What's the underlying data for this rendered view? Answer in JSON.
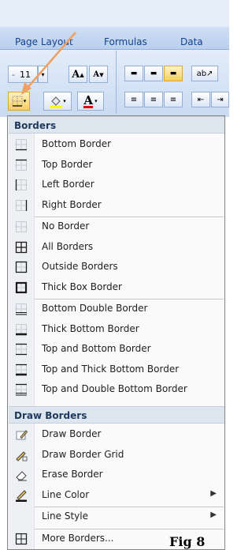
{
  "ribbon": {
    "tabs": [
      "Page Layout",
      "Formulas",
      "Data"
    ],
    "font_size": "11",
    "grow_font": "A",
    "shrink_font": "A",
    "font_color_letter": "A"
  },
  "menu": {
    "header1": "Borders",
    "items1": [
      {
        "label": "Bottom Border",
        "icon": "bottom-border-icon"
      },
      {
        "label": "Top Border",
        "icon": "top-border-icon"
      },
      {
        "label": "Left Border",
        "icon": "left-border-icon"
      },
      {
        "label": "Right Border",
        "icon": "right-border-icon"
      },
      {
        "label": "No Border",
        "icon": "no-border-icon"
      },
      {
        "label": "All Borders",
        "icon": "all-borders-icon"
      },
      {
        "label": "Outside Borders",
        "icon": "outside-borders-icon"
      },
      {
        "label": "Thick Box Border",
        "icon": "thick-box-border-icon"
      },
      {
        "label": "Bottom Double Border",
        "icon": "bottom-double-border-icon"
      },
      {
        "label": "Thick Bottom Border",
        "icon": "thick-bottom-border-icon"
      },
      {
        "label": "Top and Bottom Border",
        "icon": "top-and-bottom-border-icon"
      },
      {
        "label": "Top and Thick Bottom Border",
        "icon": "top-thick-bottom-border-icon"
      },
      {
        "label": "Top and Double Bottom Border",
        "icon": "top-double-bottom-border-icon"
      }
    ],
    "header2": "Draw Borders",
    "items2": [
      {
        "label": "Draw Border",
        "icon": "pencil-icon"
      },
      {
        "label": "Draw Border Grid",
        "icon": "pencil-grid-icon"
      },
      {
        "label": "Erase Border",
        "icon": "eraser-icon"
      },
      {
        "label": "Line Color",
        "icon": "line-color-icon",
        "submenu": true
      },
      {
        "label": "Line Style",
        "icon": "",
        "submenu": true
      },
      {
        "label": "More Borders...",
        "icon": "more-borders-icon"
      }
    ]
  },
  "caption": "Fig 8"
}
